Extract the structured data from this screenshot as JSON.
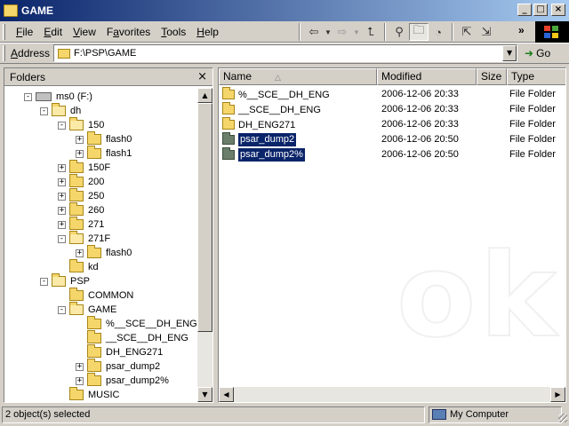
{
  "window": {
    "title": "GAME"
  },
  "menu": [
    "File",
    "Edit",
    "View",
    "Favorites",
    "Tools",
    "Help"
  ],
  "menu_underline": [
    "F",
    "E",
    "V",
    "a",
    "T",
    "H"
  ],
  "toolbar": {
    "chevron": "»",
    "icons": [
      "back-arrow-icon",
      "forward-arrow-icon",
      "up-folder-icon",
      "search-icon",
      "folders-icon",
      "history-icon",
      "move-to-icon",
      "copy-to-icon"
    ]
  },
  "address": {
    "label": "Address",
    "value": "F:\\PSP\\GAME",
    "go_label": "Go"
  },
  "folders_pane": {
    "title": "Folders",
    "close": "×",
    "tree": [
      {
        "label": "ms0 (F:)",
        "expander": "−",
        "icon": "drive"
      },
      {
        "label": "dh",
        "expander": "−",
        "icon": "folder-open"
      },
      {
        "label": "150",
        "expander": "−",
        "icon": "folder-open"
      },
      {
        "label": "flash0",
        "expander": "+",
        "icon": "folder"
      },
      {
        "label": "flash1",
        "expander": "+",
        "icon": "folder"
      },
      {
        "label": "150F",
        "expander": "+",
        "icon": "folder"
      },
      {
        "label": "200",
        "expander": "+",
        "icon": "folder"
      },
      {
        "label": "250",
        "expander": "+",
        "icon": "folder"
      },
      {
        "label": "260",
        "expander": "+",
        "icon": "folder"
      },
      {
        "label": "271",
        "expander": "+",
        "icon": "folder"
      },
      {
        "label": "271F",
        "expander": "−",
        "icon": "folder-open"
      },
      {
        "label": "flash0",
        "expander": "+",
        "icon": "folder"
      },
      {
        "label": "kd",
        "expander": "",
        "icon": "folder"
      },
      {
        "label": "PSP",
        "expander": "−",
        "icon": "folder-open"
      },
      {
        "label": "COMMON",
        "expander": "",
        "icon": "folder"
      },
      {
        "label": "GAME",
        "expander": "−",
        "icon": "folder-open"
      },
      {
        "label": "%__SCE__DH_ENG",
        "expander": "",
        "icon": "folder"
      },
      {
        "label": "__SCE__DH_ENG",
        "expander": "",
        "icon": "folder"
      },
      {
        "label": "DH_ENG271",
        "expander": "",
        "icon": "folder"
      },
      {
        "label": "psar_dump2",
        "expander": "+",
        "icon": "folder"
      },
      {
        "label": "psar_dump2%",
        "expander": "+",
        "icon": "folder"
      },
      {
        "label": "MUSIC",
        "expander": "",
        "icon": "folder"
      }
    ]
  },
  "files_pane": {
    "columns": [
      "Name",
      "Modified",
      "Size",
      "Type"
    ],
    "rows": [
      {
        "name": "%__SCE__DH_ENG",
        "modified": "2006-12-06 20:33",
        "size": "",
        "type": "File Folder",
        "selected": false
      },
      {
        "name": "__SCE__DH_ENG",
        "modified": "2006-12-06 20:33",
        "size": "",
        "type": "File Folder",
        "selected": false
      },
      {
        "name": "DH_ENG271",
        "modified": "2006-12-06 20:33",
        "size": "",
        "type": "File Folder",
        "selected": false
      },
      {
        "name": "psar_dump2",
        "modified": "2006-12-06 20:50",
        "size": "",
        "type": "File Folder",
        "selected": true
      },
      {
        "name": "psar_dump2%",
        "modified": "2006-12-06 20:50",
        "size": "",
        "type": "File Folder",
        "selected": true
      }
    ]
  },
  "status": {
    "left": "2 object(s) selected",
    "right": "My Computer"
  },
  "colors": {
    "title_start": "#0a246a",
    "title_end": "#a6caf0",
    "selection": "#0a246a",
    "face": "#d4d0c8",
    "folder": "#f5d66b"
  }
}
